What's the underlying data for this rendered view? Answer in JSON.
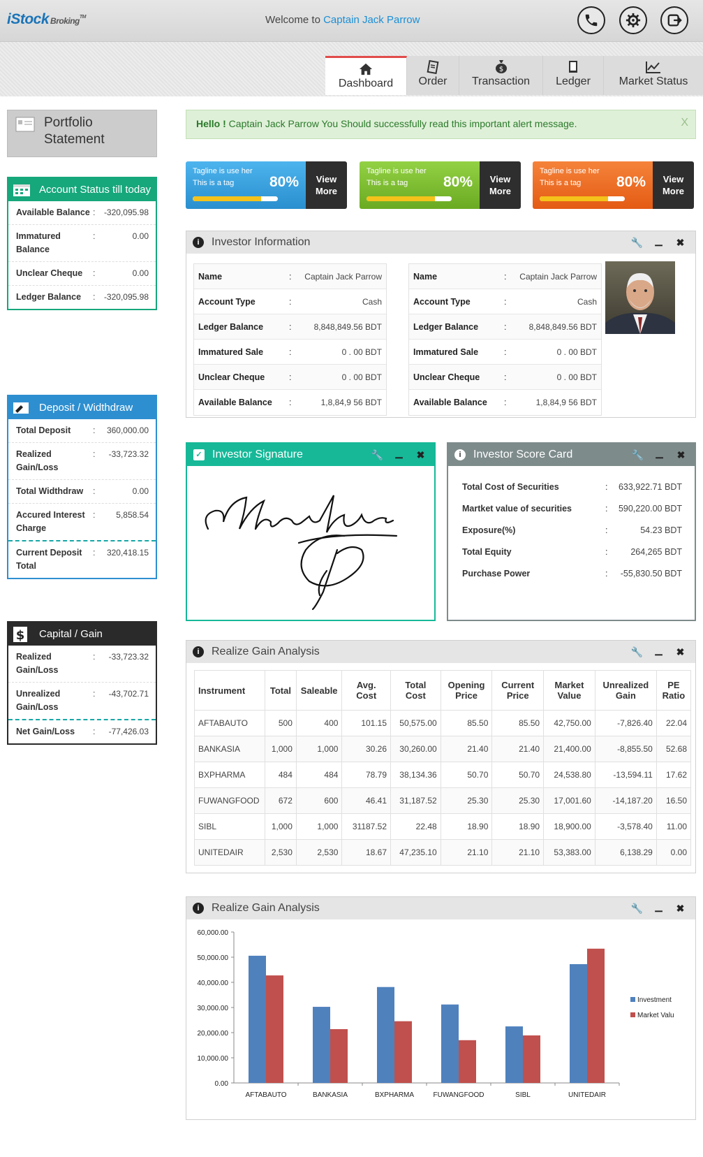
{
  "header": {
    "logo_main": "iStock",
    "logo_sub": "Broking",
    "logo_tm": "TM",
    "welcome_prefix": "Welcome to",
    "welcome_name": "Captain Jack Parrow"
  },
  "nav": {
    "tabs": [
      {
        "label": "Dashboard",
        "icon": "home-icon",
        "active": true
      },
      {
        "label": "Order",
        "icon": "clipboard-icon"
      },
      {
        "label": "Transaction",
        "icon": "money-bag-icon"
      },
      {
        "label": "Ledger",
        "icon": "book-icon"
      },
      {
        "label": "Market Status",
        "icon": "chart-line-icon"
      }
    ]
  },
  "sidebar": {
    "portfolio_title": "Portfolio Statement",
    "account_status": {
      "title": "Account Status till today",
      "color": "#16a77b",
      "rows": [
        {
          "label": "Available Balance",
          "value": "-320,095.98"
        },
        {
          "label": "Immatured Balance",
          "value": "0.00"
        },
        {
          "label": "Unclear Cheque",
          "value": "0.00"
        },
        {
          "label": "Ledger Balance",
          "value": "-320,095.98"
        }
      ]
    },
    "deposit": {
      "title": "Deposit / Widthdraw",
      "color": "#2e8fd0",
      "rows": [
        {
          "label": "Total Deposit",
          "value": "360,000.00"
        },
        {
          "label": "Realized Gain/Loss",
          "value": "-33,723.32"
        },
        {
          "label": "Total Widthdraw",
          "value": "0.00"
        },
        {
          "label": "Accured Interest Charge",
          "value": "5,858.54"
        }
      ],
      "total": {
        "label": "Current Deposit Total",
        "value": "320,418.15"
      }
    },
    "capital": {
      "title": "Capital / Gain",
      "color": "#2a2a2a",
      "rows": [
        {
          "label": "Realized Gain/Loss",
          "value": "-33,723.32"
        },
        {
          "label": "Unrealized Gain/Loss",
          "value": "-43,702.71"
        }
      ],
      "total": {
        "label": "Net Gain/Loss",
        "value": "-77,426.03"
      }
    }
  },
  "alert": {
    "bold": "Hello !",
    "text": "Captain Jack Parrow You Should successfully read this important alert message.",
    "close": "X"
  },
  "tags": [
    {
      "line1": "Tagline is use her",
      "line2": "This is a tag",
      "percent": "80%",
      "progress": 0.8,
      "button": "View More",
      "color": "#2e9ad8"
    },
    {
      "line1": "Tagline is use her",
      "line2": "This is a tag",
      "percent": "80%",
      "progress": 0.8,
      "button": "View More",
      "color": "#7bbf2a"
    },
    {
      "line1": "Tagline is use her",
      "line2": "This is a tag",
      "percent": "80%",
      "progress": 0.8,
      "button": "View More",
      "color": "#ef6a1f"
    }
  ],
  "investor": {
    "title": "Investor Information",
    "rows": [
      {
        "label": "Name",
        "value": "Captain Jack Parrow"
      },
      {
        "label": "Account Type",
        "value": "Cash"
      },
      {
        "label": "Ledger Balance",
        "value": "8,848,849.56 BDT"
      },
      {
        "label": "Immatured Sale",
        "value": "0 . 00 BDT"
      },
      {
        "label": "Unclear Cheque",
        "value": "0 . 00 BDT"
      },
      {
        "label": "Available Balance",
        "value": "1,8,84,9 56 BDT"
      }
    ]
  },
  "signature": {
    "title": "Investor Signature"
  },
  "scorecard": {
    "title": "Investor Score Card",
    "rows": [
      {
        "label": "Total Cost of Securities",
        "value": "633,922.71 BDT"
      },
      {
        "label": "Martket value of securities",
        "value": "590,220.00 BDT"
      },
      {
        "label": "Exposure(%)",
        "value": "54.23 BDT"
      },
      {
        "label": "Total Equity",
        "value": "264,265 BDT"
      },
      {
        "label": "Purchase Power",
        "value": "-55,830.50 BDT"
      }
    ]
  },
  "gain_table": {
    "title": "Realize Gain Analysis",
    "headers": [
      "Instrument",
      "Total",
      "Saleable",
      "Avg. Cost",
      "Total Cost",
      "Opening Price",
      "Current Price",
      "Market Value",
      "Unrealized Gain",
      "PE Ratio"
    ],
    "rows": [
      [
        "AFTABAUTO",
        "500",
        "400",
        "101.15",
        "50,575.00",
        "85.50",
        "85.50",
        "42,750.00",
        "-7,826.40",
        "22.04"
      ],
      [
        "BANKASIA",
        "1,000",
        "1,000",
        "30.26",
        "30,260.00",
        "21.40",
        "21.40",
        "21,400.00",
        "-8,855.50",
        "52.68"
      ],
      [
        "BXPHARMA",
        "484",
        "484",
        "78.79",
        "38,134.36",
        "50.70",
        "50.70",
        "24,538.80",
        "-13,594.11",
        "17.62"
      ],
      [
        "FUWANGFOOD",
        "672",
        "600",
        "46.41",
        "31,187.52",
        "25.30",
        "25.30",
        "17,001.60",
        "-14,187.20",
        "16.50"
      ],
      [
        "SIBL",
        "1,000",
        "1,000",
        "31187.52",
        "22.48",
        "18.90",
        "18.90",
        "18,900.00",
        "-3,578.40",
        "11.00"
      ],
      [
        "UNITEDAIR",
        "2,530",
        "2,530",
        "18.67",
        "47,235.10",
        "21.10",
        "21.10",
        "53,383.00",
        "6,138.29",
        "0.00"
      ]
    ]
  },
  "chart_panel": {
    "title": "Realize Gain Analysis"
  },
  "chart_data": {
    "type": "bar",
    "categories": [
      "AFTABAUTO",
      "BANKASIA",
      "BXPHARMA",
      "FUWANGFOOD",
      "SIBL",
      "UNITEDAIR"
    ],
    "series": [
      {
        "name": "Investment",
        "values": [
          50575,
          30260,
          38134,
          31188,
          22480,
          47235
        ],
        "color": "#4f81bd"
      },
      {
        "name": "Market Valu",
        "values": [
          42750,
          21400,
          24539,
          17002,
          18900,
          53383
        ],
        "color": "#c0504d"
      }
    ],
    "yticks": [
      "0.00",
      "10,000.00",
      "20,000.00",
      "30,000.00",
      "40,000.00",
      "50,000.00",
      "60,000.00"
    ],
    "ylim": [
      0,
      60000
    ],
    "grid": false,
    "legend": "right"
  }
}
